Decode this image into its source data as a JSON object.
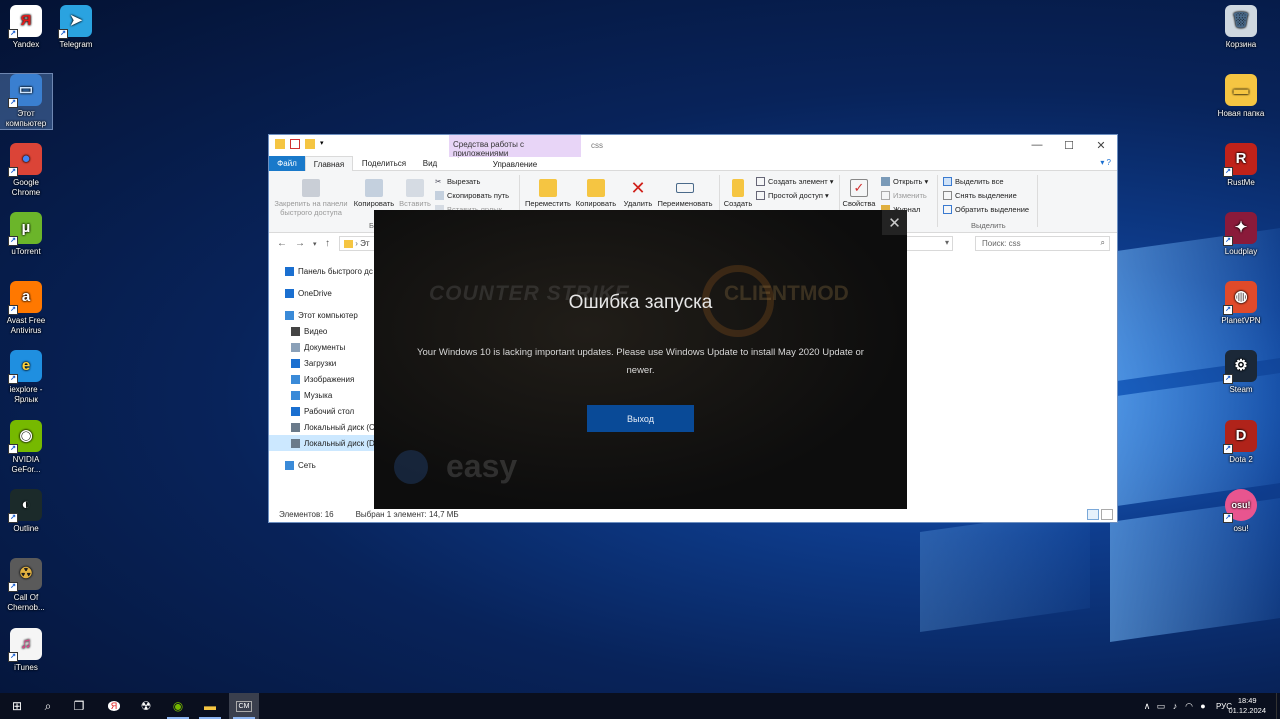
{
  "desktop": {
    "left_icons": [
      {
        "label": "Yandex",
        "icon": "yandex-icon",
        "color": "#ffffff",
        "glyph": "Я",
        "glyph_color": "#e01b1b"
      },
      {
        "label": "Telegram",
        "icon": "telegram-icon",
        "color": "#2aa3e0",
        "glyph": "➤",
        "glyph_color": "#ffffff"
      },
      {
        "label": "Этот компьютер",
        "icon": "this-pc-icon",
        "color": "#3a7fd0",
        "glyph": "▭",
        "glyph_color": "#cfe6ff"
      },
      {
        "label": "Google Chrome",
        "icon": "chrome-icon",
        "color": "#db4437",
        "glyph": "●",
        "glyph_color": "#4285f4"
      },
      {
        "label": "uTorrent",
        "icon": "utorrent-icon",
        "color": "#6bb52a",
        "glyph": "µ",
        "glyph_color": "#ffffff"
      },
      {
        "label": "Avast Free Antivirus",
        "icon": "avast-icon",
        "color": "#ff7800",
        "glyph": "a",
        "glyph_color": "#ffffff"
      },
      {
        "label": "iexplore - Ярлык",
        "icon": "internet-explorer-icon",
        "color": "#1f8fe0",
        "glyph": "e",
        "glyph_color": "#ffd23a"
      },
      {
        "label": "NVIDIA GeFor...",
        "icon": "nvidia-icon",
        "color": "#76b900",
        "glyph": "◉",
        "glyph_color": "#ffffff"
      },
      {
        "label": "Outline",
        "icon": "outline-icon",
        "color": "#1b2a2a",
        "glyph": "◐",
        "glyph_color": "#ffffff"
      },
      {
        "label": "Call Of Chernob...",
        "icon": "call-of-chernobyl-icon",
        "color": "#5a5a5a",
        "glyph": "☢",
        "glyph_color": "#e0b040"
      },
      {
        "label": "iTunes",
        "icon": "itunes-icon",
        "color": "#f5f5f5",
        "glyph": "♫",
        "glyph_color": "#e0408a"
      }
    ],
    "right_icons": [
      {
        "label": "Корзина",
        "icon": "recycle-bin-icon",
        "color": "#cfd8e0",
        "glyph": "🗑",
        "glyph_color": "#4a6a8a"
      },
      {
        "label": "Новая папка",
        "icon": "folder-icon",
        "color": "#f5c542",
        "glyph": "▬",
        "glyph_color": "#f5c542"
      },
      {
        "label": "RustMe",
        "icon": "rustme-icon",
        "color": "#c0221a",
        "glyph": "R",
        "glyph_color": "#ffffff"
      },
      {
        "label": "Loudplay",
        "icon": "loudplay-icon",
        "color": "#8a1a3a",
        "glyph": "✦",
        "glyph_color": "#ffffff"
      },
      {
        "label": "PlanetVPN",
        "icon": "planetvpn-icon",
        "color": "#e04a2a",
        "glyph": "◍",
        "glyph_color": "#ffffff"
      },
      {
        "label": "Steam",
        "icon": "steam-icon",
        "color": "#1b2838",
        "glyph": "⚙",
        "glyph_color": "#ffffff"
      },
      {
        "label": "Dota 2",
        "icon": "dota2-icon",
        "color": "#b0231a",
        "glyph": "D",
        "glyph_color": "#ffffff"
      },
      {
        "label": "osu!",
        "icon": "osu-icon",
        "color": "#e8558f",
        "glyph": "osu!",
        "glyph_color": "#ffffff"
      }
    ]
  },
  "explorer": {
    "context_tab_group": "Средства работы с приложениями",
    "window_title": "css",
    "tabs": {
      "file": "Файл",
      "home": "Главная",
      "share": "Поделиться",
      "view": "Вид",
      "manage": "Управление"
    },
    "ribbon": {
      "pin": "Закрепить на панели быстрого доступа",
      "copy": "Копировать",
      "paste": "Вставить",
      "cut": "Вырезать",
      "copy_path": "Скопировать путь",
      "paste_shortcut": "Вставить ярлык",
      "move_to": "Переместить",
      "copy_to": "Копировать",
      "delete": "Удалить",
      "rename": "Переименовать",
      "new_folder": "Создать",
      "new_item": "Создать элемент ▾",
      "easy_access": "Простой доступ ▾",
      "properties": "Свойства",
      "open": "Открыть ▾",
      "edit": "Изменить",
      "history": "Журнал",
      "select_all": "Выделить все",
      "select_none": "Снять выделение",
      "invert_selection": "Обратить выделение",
      "group_select": "Выделить",
      "group_clipboard": "Б"
    },
    "address": "Эт",
    "search_placeholder": "Поиск: css",
    "tree": [
      {
        "label": "Панель быстрого дс",
        "icon": "star-icon",
        "color": "#1a6fd0",
        "indent": 0
      },
      {
        "label": "OneDrive",
        "icon": "onedrive-icon",
        "color": "#1a6fd0",
        "indent": 0
      },
      {
        "label": "Этот компьютер",
        "icon": "computer-icon",
        "color": "#3a8ad8",
        "indent": 0
      },
      {
        "label": "Видео",
        "icon": "video-icon",
        "color": "#444444",
        "indent": 1
      },
      {
        "label": "Документы",
        "icon": "documents-icon",
        "color": "#8aa0b8",
        "indent": 1
      },
      {
        "label": "Загрузки",
        "icon": "downloads-icon",
        "color": "#1a6fd0",
        "indent": 1
      },
      {
        "label": "Изображения",
        "icon": "pictures-icon",
        "color": "#3a8ad8",
        "indent": 1
      },
      {
        "label": "Музыка",
        "icon": "music-icon",
        "color": "#3a8ad8",
        "indent": 1
      },
      {
        "label": "Рабочий стол",
        "icon": "desktop-icon",
        "color": "#1a6fd0",
        "indent": 1
      },
      {
        "label": "Локальный диск (С",
        "icon": "drive-c-icon",
        "color": "#6a7a8a",
        "indent": 1
      },
      {
        "label": "Локальный диск (D",
        "icon": "drive-d-icon",
        "color": "#6a7a8a",
        "indent": 1
      },
      {
        "label": "Сеть",
        "icon": "network-icon",
        "color": "#3a8ad8",
        "indent": 0
      }
    ],
    "status": {
      "items": "Элементов: 16",
      "selected": "Выбран 1 элемент: 14,7 МБ"
    }
  },
  "dialog": {
    "logo_left": "COUNTER STRIKE",
    "logo_right": "CLIENTMOD",
    "logo_bottom": "easy",
    "title": "Ошибка запуска",
    "message": "Your Windows 10 is lacking important updates. Please use Windows Update to install May 2020 Update or newer.",
    "button": "Выход",
    "accent": "#094a97"
  },
  "taskbar": {
    "apps": [
      {
        "name": "start-icon",
        "glyph": "⊞"
      },
      {
        "name": "search-icon",
        "glyph": "⌕"
      },
      {
        "name": "task-view-icon",
        "glyph": "❐"
      },
      {
        "name": "yandex-taskbar-icon",
        "glyph": "Я"
      },
      {
        "name": "chernobyl-taskbar-icon",
        "glyph": "☢"
      },
      {
        "name": "nvidia-taskbar-icon",
        "glyph": "◉"
      },
      {
        "name": "explorer-taskbar-icon",
        "glyph": "▬"
      },
      {
        "name": "clientmod-taskbar-icon",
        "glyph": "CM"
      }
    ],
    "lang": "РУС",
    "time": "18:49",
    "date": "01.12.2024"
  }
}
